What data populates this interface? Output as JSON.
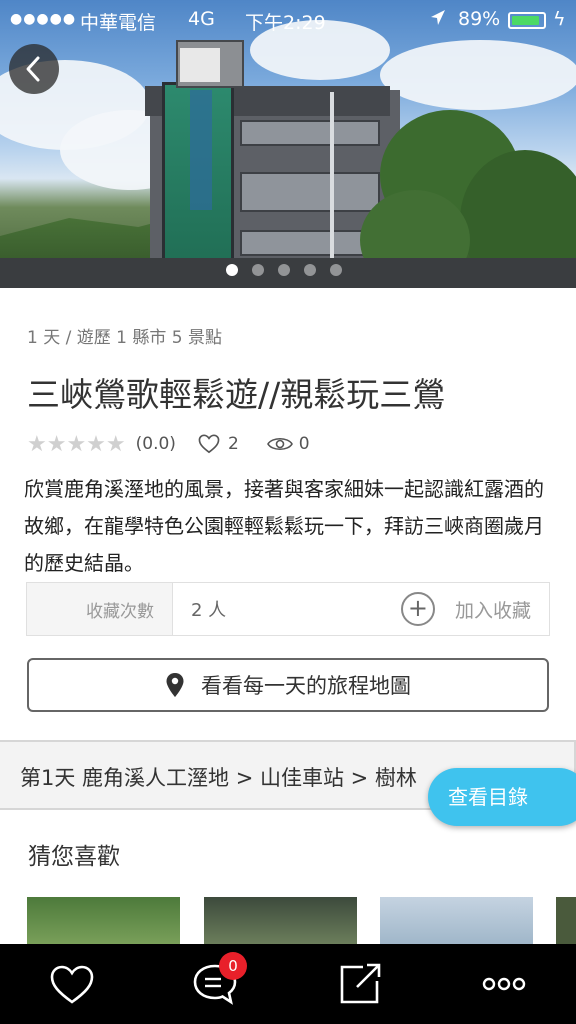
{
  "status_bar": {
    "signal": "●●●●●",
    "carrier": "中華電信",
    "network": "4G",
    "time": "下午2:29",
    "battery_percent": "89%",
    "battery_level": 0.89
  },
  "hero": {
    "slide_count": 5,
    "active_slide": 1
  },
  "trip": {
    "summary": "1 天 / 遊歷 1 縣市 5 景點",
    "title": "三峽鶯歌輕鬆遊//親鬆玩三鶯",
    "stars": "★★★★★",
    "rating": 0.0,
    "rating_text": "(0.0)",
    "likes": "2",
    "views": "0",
    "description": "欣賞鹿角溪溼地的風景，接著與客家細妹一起認識紅露酒的故鄉，在龍學特色公園輕輕鬆鬆玩一下，拜訪三峽商圈歲月的歷史結晶。"
  },
  "favorite": {
    "label": "收藏次數",
    "count": "2 人",
    "add_label": "加入收藏",
    "plus": "+"
  },
  "map_button_label": "看看每一天的旅程地圖",
  "day_bar_text": "第1天  鹿角溪人工溼地 > 山佳車站 > 樹林",
  "toc_button_label": "查看目錄",
  "suggest_title": "猜您喜歡",
  "tab_bar": {
    "comment_badge": "0",
    "icons": [
      "heart-icon",
      "comment-icon",
      "share-icon",
      "more-icon"
    ]
  },
  "colors": {
    "accent": "#3fc3ee",
    "badge": "#e8202a",
    "battery": "#4cd964"
  }
}
